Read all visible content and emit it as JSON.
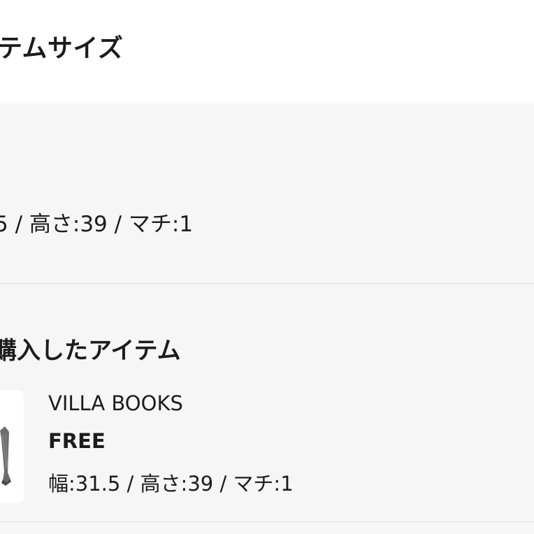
{
  "header": {
    "title": "テムサイズ"
  },
  "size_card": {
    "dimensions": "5 / 高さ:39 / マチ:1"
  },
  "purchased": {
    "title": "購入したアイテム",
    "item": {
      "brand": "VILLA BOOKS",
      "size": "FREE",
      "dimensions": "幅:31.5 / 高さ:39 / マチ:1"
    }
  }
}
